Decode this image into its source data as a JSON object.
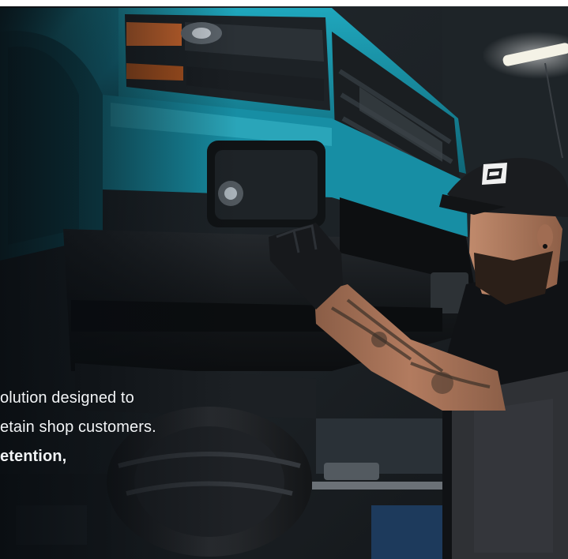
{
  "hero": {
    "copy_lines": [
      "olution designed to",
      "etain shop customers.",
      "etention,"
    ]
  },
  "palette": {
    "truck_teal": "#1a98ad",
    "truck_dark_teal": "#0d4f5c",
    "bumper_black": "#14171a",
    "shop_background": "#1b2024",
    "skin": "#a8745a",
    "tattoo_ink": "#3b3028",
    "shirt_black": "#101215",
    "apron_gray": "#2f3135",
    "ceiling_light": "#f4f2e6",
    "text_white": "#f2f4f6"
  },
  "icons": {
    "cap_logo": "cap-logo-icon"
  }
}
